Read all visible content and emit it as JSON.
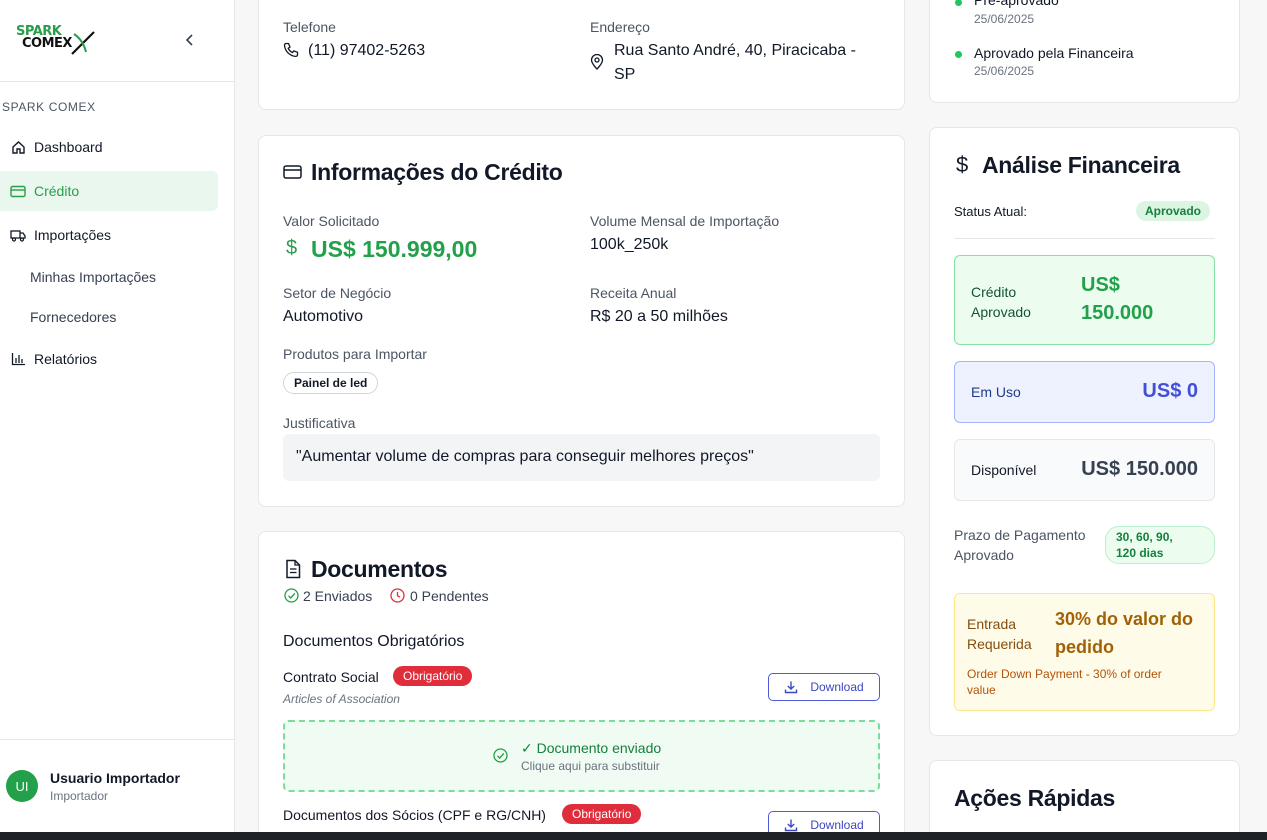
{
  "sidebar": {
    "logo_line1": "SPARK",
    "logo_line2": "COMEX",
    "section": "SPARK COMEX",
    "items": [
      {
        "label": "Dashboard"
      },
      {
        "label": "Crédito"
      },
      {
        "label": "Importações"
      },
      {
        "label": "Minhas Importações"
      },
      {
        "label": "Fornecedores"
      },
      {
        "label": "Relatórios"
      }
    ],
    "user": {
      "initials": "UI",
      "name": "Usuario Importador",
      "role": "Importador"
    }
  },
  "contact": {
    "phone_label": "Telefone",
    "phone": "(11) 97402-5263",
    "address_label": "Endereço",
    "address_line1": "Rua Santo André, 40, Piracicaba -",
    "address_line2": "SP"
  },
  "credit": {
    "title": "Informações do Crédito",
    "valor_label": "Valor Solicitado",
    "valor": "US$ 150.999,00",
    "volume_label": "Volume Mensal de Importação",
    "volume": "100k_250k",
    "setor_label": "Setor de Negócio",
    "setor": "Automotivo",
    "receita_label": "Receita Anual",
    "receita": "R$ 20 a 50 milhões",
    "produtos_label": "Produtos para Importar",
    "produtos": [
      "Painel de led"
    ],
    "justificativa_label": "Justificativa",
    "justificativa": "\"Aumentar volume de compras para conseguir melhores preços\""
  },
  "documents": {
    "title": "Documentos",
    "sent": "2 Enviados",
    "pending": "0 Pendentes",
    "section": "Documentos Obrigatórios",
    "items": [
      {
        "name": "Contrato Social",
        "badge": "Obrigatório",
        "subtitle": "Articles of Association",
        "download": "Download"
      },
      {
        "name": "Documentos dos Sócios (CPF e RG/CNH)",
        "badge": "Obrigatório",
        "download": "Download"
      }
    ],
    "upload_status": "✓ Documento enviado",
    "upload_hint": "Clique aqui para substituir"
  },
  "timeline": {
    "items": [
      {
        "label": "Pré-aprovado",
        "date": "25/06/2025"
      },
      {
        "label": "Aprovado pela Financeira",
        "date": "25/06/2025"
      }
    ]
  },
  "analysis": {
    "title": "Análise Financeira",
    "status_label": "Status Atual:",
    "status": "Aprovado",
    "approved_label": "Crédito Aprovado",
    "approved_line1": "US$",
    "approved_line2": "150.000",
    "in_use_label": "Em Uso",
    "in_use": "US$ 0",
    "available_label": "Disponível",
    "available": "US$ 150.000",
    "term_label_line1": "Prazo de Pagamento",
    "term_label_line2": "Aprovado",
    "term_line1": "30, 60, 90,",
    "term_line2": "120 dias",
    "down_label_line1": "Entrada",
    "down_label_line2": "Requerida",
    "down_value_line1": "30% do valor do",
    "down_value_line2": "pedido",
    "down_note_line1": "Order Down Payment - 30% of order",
    "down_note_line2": "value"
  },
  "quick_actions": {
    "title": "Ações Rápidas"
  },
  "colors": {
    "brand_green": "#2a9d4b",
    "approved_bg": "#ecfdf0",
    "in_use_bg": "#eef2ff",
    "danger": "#e02d3c",
    "warning_bg": "#fefbe8"
  }
}
